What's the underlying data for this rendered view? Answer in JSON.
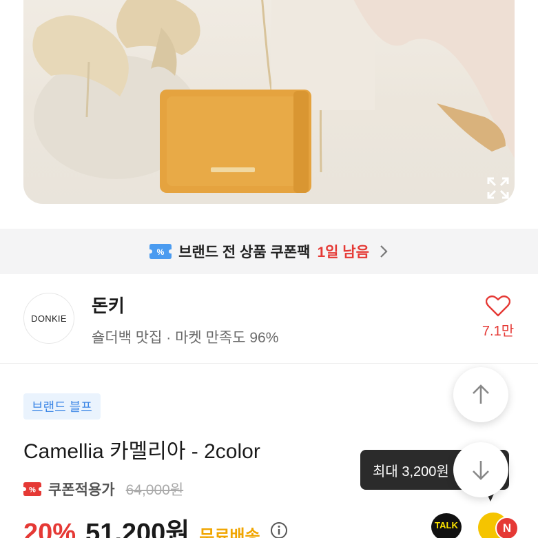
{
  "product_image": {
    "alt": "product-photo",
    "expand_icon": "expand-icon"
  },
  "coupon_banner": {
    "icon": "coupon-icon",
    "text": "브랜드 전 상품 쿠폰팩",
    "highlight": "1일 남음",
    "chevron": "chevron-right-icon"
  },
  "store": {
    "logo_text": "DONKIE",
    "name": "돈키",
    "description": "숄더백 맛집 · 마켓 만족도 96%",
    "like_icon": "heart-icon",
    "like_count": "7.1만"
  },
  "product": {
    "brand_tag": "브랜드 블프",
    "name": "Camellia 카멜리아 - 2color",
    "coupon_label": "쿠폰적용가",
    "original_price": "64,000원",
    "discount": "20%",
    "price": "51,200원",
    "shipping": "무료배송",
    "info_icon": "info-icon"
  },
  "floating": {
    "tooltip": "최대 3,200원",
    "scroll_up_icon": "arrow-up-icon",
    "scroll_down_icon": "arrow-down-icon",
    "talk_label": "TALK",
    "n_badge": "N"
  },
  "colors": {
    "accent_red": "#e53935",
    "brand_blue": "#3d87e6",
    "shipping_yellow": "#f0a500",
    "bag_mustard": "#e5a33f"
  }
}
